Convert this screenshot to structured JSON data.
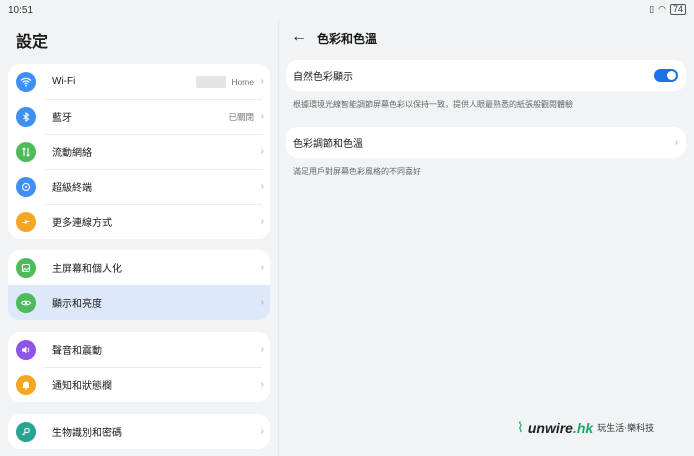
{
  "status": {
    "time": "10:51",
    "battery": "74"
  },
  "settings": {
    "title": "設定"
  },
  "groups": [
    [
      {
        "label": "Wi-Fi",
        "value": "Home",
        "icon": "wifi-icon",
        "color": "#3f8ff5"
      },
      {
        "label": "藍牙",
        "value": "已關閉",
        "icon": "bluetooth-icon",
        "color": "#3f8ff5"
      },
      {
        "label": "流動網絡",
        "value": "",
        "icon": "mobile-network-icon",
        "color": "#4cbb5a"
      },
      {
        "label": "超級終端",
        "value": "",
        "icon": "super-device-icon",
        "color": "#3f8ff5"
      },
      {
        "label": "更多連線方式",
        "value": "",
        "icon": "more-connections-icon",
        "color": "#f5a623"
      }
    ],
    [
      {
        "label": "主屏幕和個人化",
        "value": "",
        "icon": "home-screen-icon",
        "color": "#4cbb5a"
      },
      {
        "label": "顯示和亮度",
        "value": "",
        "icon": "eye-icon",
        "color": "#4cbb5a",
        "selected": true
      }
    ],
    [
      {
        "label": "聲音和震動",
        "value": "",
        "icon": "sound-icon",
        "color": "#8e55e8"
      },
      {
        "label": "通知和狀態欄",
        "value": "",
        "icon": "bell-icon",
        "color": "#f5a623"
      }
    ],
    [
      {
        "label": "生物識別和密碼",
        "value": "",
        "icon": "key-icon",
        "color": "#27a58e"
      }
    ]
  ],
  "detail": {
    "title": "色彩和色溫",
    "natural_color_label": "自然色彩顯示",
    "natural_color_on": true,
    "natural_color_desc": "根據環境光線智能調節屏幕色彩以保持一致，提供人眼最熟悉的紙張般觀閱體驗",
    "color_adjust_label": "色彩調節和色溫",
    "color_adjust_desc": "滿足用戶對屏幕色彩風格的不同喜好"
  },
  "watermark": {
    "logo_main": "unwire",
    "logo_suffix": ".hk",
    "tagline": "玩生活‧樂科技"
  },
  "colors": {
    "accent": "#1f6fe6",
    "selected_bg": "#dde9fb",
    "background": "#f1f3f5"
  }
}
